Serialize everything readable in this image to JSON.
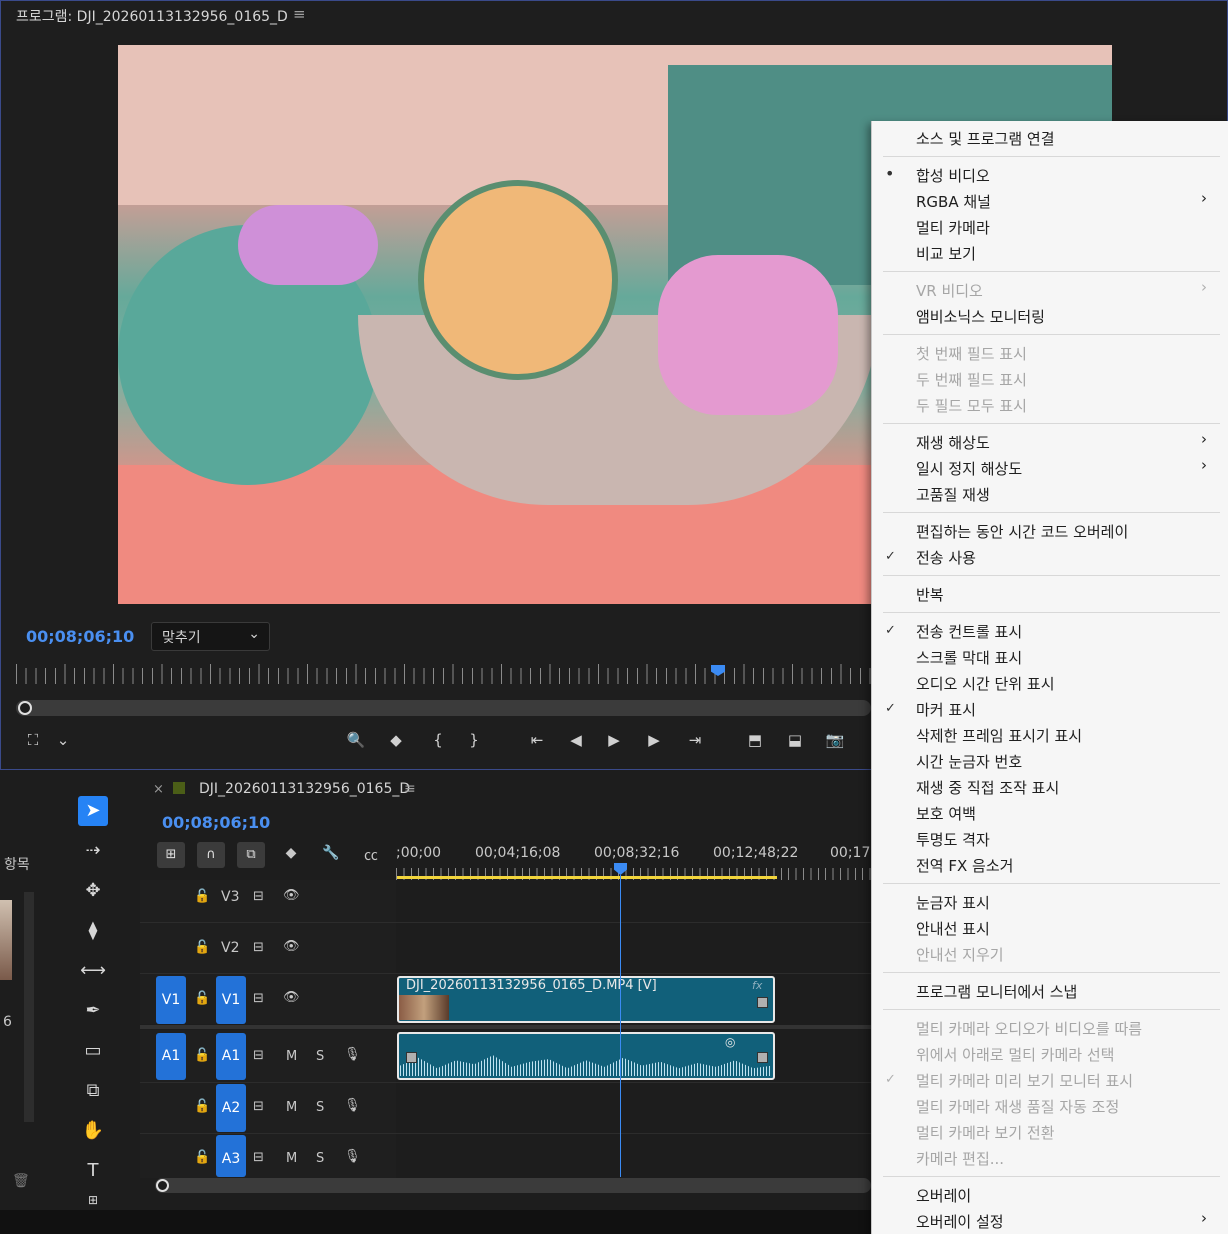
{
  "program_monitor": {
    "title": "프로그램: DJI_20260113132956_0165_D",
    "menu_icon": "≡",
    "timecode": "00;08;06;10",
    "fit_select": "맞추기"
  },
  "left_panel": {
    "label": "항목",
    "count": "6"
  },
  "sequence": {
    "close": "×",
    "title": "DJI_20260113132956_0165_D",
    "menu_icon": "≡",
    "timecode": "00;08;06;10",
    "ruler_times": [
      ";00;00",
      "00;04;16;08",
      "00;08;32;16",
      "00;12;48;22",
      "00;17;"
    ]
  },
  "tracks": {
    "v3": "V3",
    "v2": "V2",
    "v1_source": "V1",
    "v1": "V1",
    "a1_source": "A1",
    "a1": "A1",
    "a2": "A2",
    "a3": "A3",
    "mute": "M",
    "solo": "S"
  },
  "clips": {
    "video_label": "DJI_20260113132956_0165_D.MP4 [V]",
    "fx": "fx"
  },
  "context_menu": {
    "items": [
      {
        "label": "소스 및 프로그램 연결"
      },
      {
        "label": "합성 비디오"
      },
      {
        "label": "RGBA 채널"
      },
      {
        "label": "멀티 카메라"
      },
      {
        "label": "비교 보기"
      },
      {
        "label": "VR 비디오"
      },
      {
        "label": "앰비소닉스 모니터링"
      },
      {
        "label": "첫 번째 필드 표시"
      },
      {
        "label": "두 번째 필드 표시"
      },
      {
        "label": "두 필드 모두 표시"
      },
      {
        "label": "재생 해상도"
      },
      {
        "label": "일시 정지 해상도"
      },
      {
        "label": "고품질 재생"
      },
      {
        "label": "편집하는 동안 시간 코드 오버레이"
      },
      {
        "label": "전송 사용"
      },
      {
        "label": "반복"
      },
      {
        "label": "전송 컨트롤 표시"
      },
      {
        "label": "스크롤 막대 표시"
      },
      {
        "label": "오디오 시간 단위 표시"
      },
      {
        "label": "마커 표시"
      },
      {
        "label": "삭제한 프레임 표시기 표시"
      },
      {
        "label": "시간 눈금자 번호"
      },
      {
        "label": "재생 중 직접 조작 표시"
      },
      {
        "label": "보호 여백"
      },
      {
        "label": "투명도 격자"
      },
      {
        "label": "전역 FX 음소거"
      },
      {
        "label": "눈금자 표시"
      },
      {
        "label": "안내선 표시"
      },
      {
        "label": "안내선 지우기"
      },
      {
        "label": "프로그램 모니터에서 스냅"
      },
      {
        "label": "멀티 카메라 오디오가 비디오를 따름"
      },
      {
        "label": "위에서 아래로 멀티 카메라 선택"
      },
      {
        "label": "멀티 카메라 미리 보기 모니터 표시"
      },
      {
        "label": "멀티 카메라 재생 품질 자동 조정"
      },
      {
        "label": "멀티 카메라 보기 전환"
      },
      {
        "label": "카메라 편집..."
      },
      {
        "label": "오버레이"
      },
      {
        "label": "오버레이 설정"
      }
    ],
    "bullet": "•",
    "check": "✓",
    "submenu_arrow": "›"
  }
}
